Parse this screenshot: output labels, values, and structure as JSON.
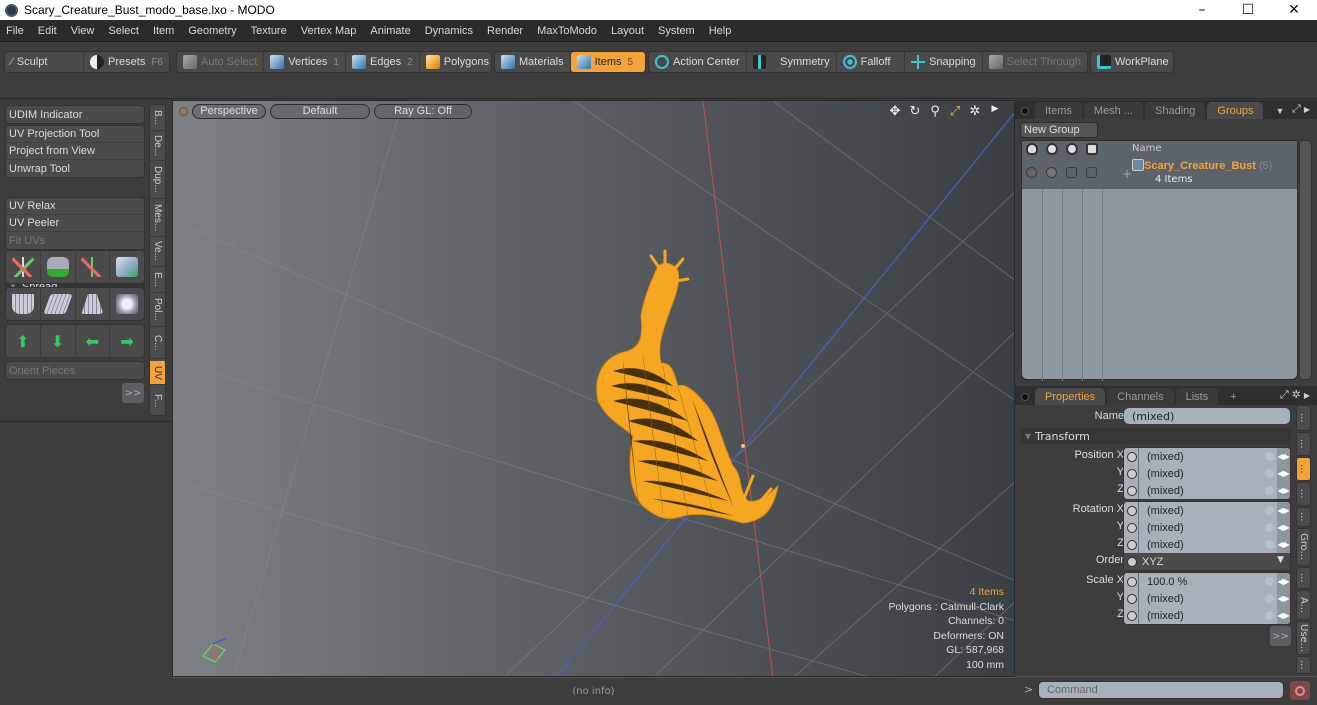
{
  "window": {
    "title": "Scary_Creature_Bust_modo_base.lxo - MODO",
    "controls": [
      "–",
      "☐",
      "✕"
    ]
  },
  "menu": [
    "File",
    "Edit",
    "View",
    "Select",
    "Item",
    "Geometry",
    "Texture",
    "Vertex Map",
    "Animate",
    "Dynamics",
    "Render",
    "MaxToModo",
    "Layout",
    "System",
    "Help"
  ],
  "toolbar": {
    "sculpt": "Sculpt",
    "presets": "Presets",
    "presets_key": "F6",
    "auto_select": "Auto Select",
    "vertices": "Vertices",
    "vertices_key": "1",
    "edges": "Edges",
    "edges_key": "2",
    "polygons": "Polygons",
    "materials": "Materials",
    "items": "Items",
    "items_key": "5",
    "action_center": "Action Center",
    "symmetry": "Symmetry",
    "falloff": "Falloff",
    "snapping": "Snapping",
    "select_through": "Select Through",
    "workplane": "WorkPlane"
  },
  "left_panel": {
    "udim": "UDIM Indicator",
    "group1": [
      "UV Projection Tool",
      "Project from View",
      "Unwrap Tool"
    ],
    "spread": "Spread",
    "group2": [
      "UV Relax",
      "UV Peeler",
      "Fit UVs"
    ],
    "orient_pieces": "Orient Pieces",
    "more": ">>",
    "vtabs": [
      "B...",
      "De...",
      "Dup...",
      "Mes...",
      "Ve...",
      "E...",
      "Pol...",
      "C...",
      "UV",
      "F..."
    ],
    "active_vtab": "UV"
  },
  "viewport": {
    "view": "Perspective",
    "shading": "Default",
    "raygl": "Ray GL: Off",
    "info": {
      "items": "4 Items",
      "polygons": "Polygons : Catmull-Clark",
      "channels": "Channels: 0",
      "deformers": "Deformers: ON",
      "gl": "GL: 587,968",
      "scale": "100 mm"
    },
    "status": "(no info)"
  },
  "scene_panel": {
    "tabs": [
      "Items",
      "Mesh ...",
      "Shading",
      "Groups"
    ],
    "active_tab": "Groups",
    "new_group": "New Group",
    "col_name": "Name",
    "group": {
      "name": "Scary_Creature_Bust",
      "count": "(5)",
      "sub": "4 Items"
    }
  },
  "properties": {
    "tabs": [
      "Properties",
      "Channels",
      "Lists",
      "+"
    ],
    "active_tab": "Properties",
    "name_label": "Name",
    "name_value": "(mixed)",
    "transform": "Transform",
    "position": {
      "label_x": "Position X",
      "label_y": "Y",
      "label_z": "Z",
      "x": "(mixed)",
      "y": "(mixed)",
      "z": "(mixed)"
    },
    "rotation": {
      "label_x": "Rotation X",
      "label_y": "Y",
      "label_z": "Z",
      "x": "(mixed)",
      "y": "(mixed)",
      "z": "(mixed)"
    },
    "order": {
      "label": "Order",
      "value": "XYZ"
    },
    "scale": {
      "label_x": "Scale X",
      "label_y": "Y",
      "label_z": "Z",
      "x": "100.0 %",
      "y": "(mixed)",
      "z": "(mixed)"
    },
    "more": ">>",
    "vtabs": [
      "...",
      "...",
      "...",
      "...",
      "...",
      "Gro...",
      "...",
      "A...",
      "Use...",
      "..."
    ]
  },
  "command": {
    "prompt": ">",
    "placeholder": "Command"
  },
  "colors": {
    "accent": "#f2a33a",
    "mesh": "#f5a623",
    "axis_red": "#c0504d",
    "axis_blue": "#4a5fc4"
  }
}
